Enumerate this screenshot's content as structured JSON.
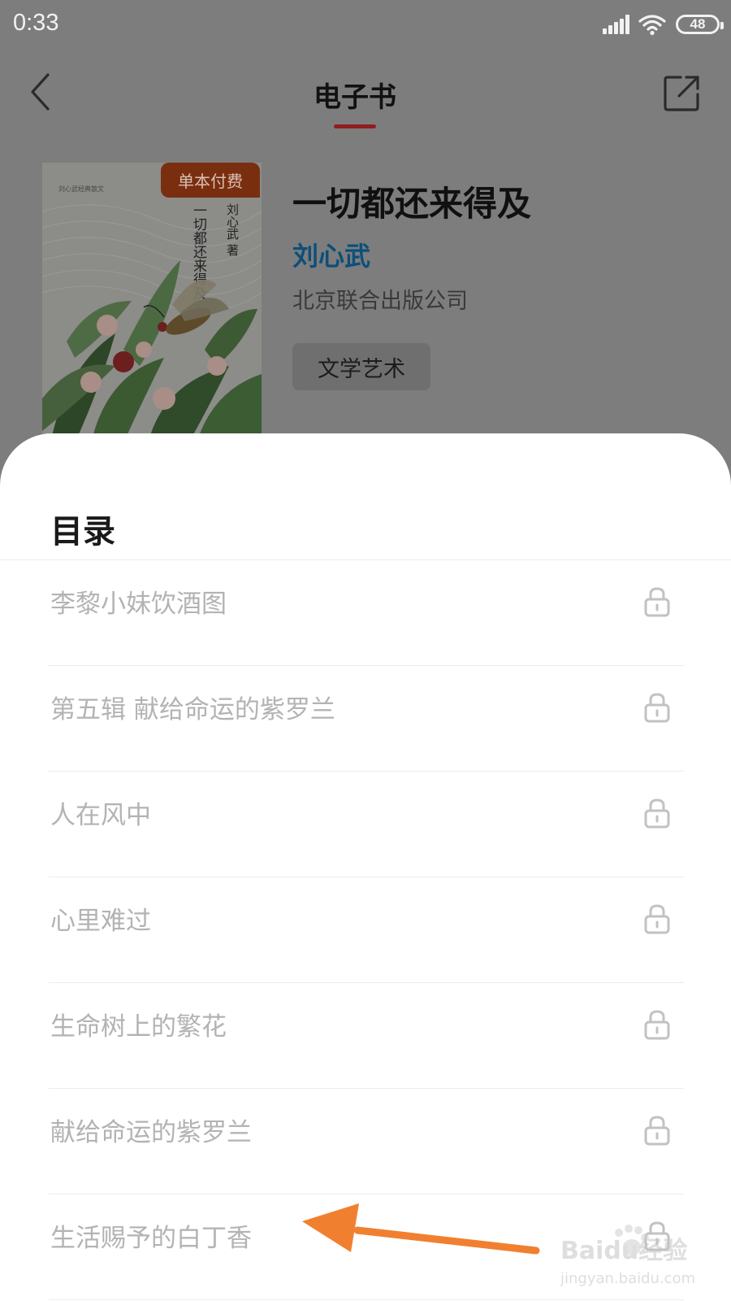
{
  "status_bar": {
    "time": "0:33",
    "battery": "48"
  },
  "header": {
    "title": "电子书"
  },
  "book": {
    "badge": "单本付费",
    "title": "一切都还来得及",
    "author": "刘心武",
    "publisher": "北京联合出版公司",
    "category": "文学艺术",
    "cover_text": {
      "title": "一切都还来得及",
      "author": "刘心武 著"
    }
  },
  "toc": {
    "heading": "目录",
    "items": [
      {
        "label": "李黎小妹饮酒图"
      },
      {
        "label": "第五辑 献给命运的紫罗兰"
      },
      {
        "label": "人在风中"
      },
      {
        "label": "心里难过"
      },
      {
        "label": "生命树上的繁花"
      },
      {
        "label": "献给命运的紫罗兰"
      },
      {
        "label": "生活赐予的白丁香"
      }
    ]
  },
  "watermark": {
    "brand": "Baidu经验",
    "url": "jingyan.baidu.com"
  },
  "colors": {
    "accent": "#d43b3b",
    "annotation_arrow": "#f08030",
    "locked_text": "#b3b3b3"
  }
}
